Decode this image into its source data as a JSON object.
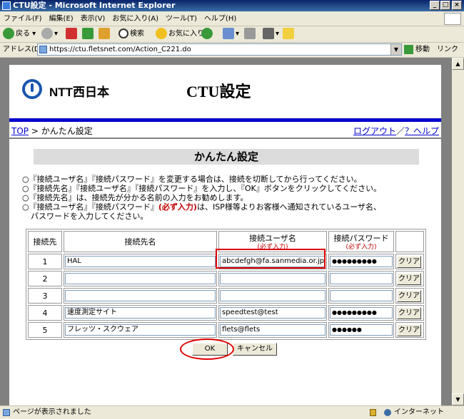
{
  "window": {
    "title": "CTU設定 - Microsoft Internet Explorer"
  },
  "menu": [
    "ファイル(F)",
    "編集(E)",
    "表示(V)",
    "お気に入り(A)",
    "ツール(T)",
    "ヘルプ(H)"
  ],
  "toolbar": {
    "back": "戻る",
    "search": "検索",
    "favorites": "お気に入り"
  },
  "address": {
    "label": "アドレス(D)",
    "url": "https://ctu.fletsnet.com/Action_C221.do",
    "go": "移動",
    "links": "リンク"
  },
  "page": {
    "logo_text": "NTT西日本",
    "title": "CTU設定",
    "breadcrumb_top": "TOP",
    "breadcrumb_sep": " > ",
    "breadcrumb_current": "かんたん設定",
    "logout": "ログアウト",
    "nav_sep": "／",
    "help": "？ヘルプ",
    "section_title": "かんたん設定",
    "notes": [
      "○『接続ユーザ名』『接続パスワード』を変更する場合は、接続を切断してから行ってください。",
      "○『接続先名』『接続ユーザ名』『接続パスワード』を入力し、『OK』ボタンをクリックしてください。",
      "○『接続先名』は、接続先が分かる名前の入力をお勧めします。"
    ],
    "note4_pre": "○『接続ユーザ名』『接続パスワード』",
    "note4_req": "(必ず入力)",
    "note4_post": "は、ISP様等よりお客様へ通知されているユーザ名、",
    "note4_line2": "パスワードを入力してください。",
    "table": {
      "headers": [
        "接続先",
        "接続先名",
        "接続ユーザ名",
        "接続パスワード"
      ],
      "required": "(必ず入力)",
      "clear_label": "クリア",
      "rows": [
        {
          "no": "1",
          "name": "HAL",
          "user": "abcdefgh@fa.sanmedia.or.jp",
          "password": "●●●●●●●●●"
        },
        {
          "no": "2",
          "name": "",
          "user": "",
          "password": ""
        },
        {
          "no": "3",
          "name": "",
          "user": "",
          "password": ""
        },
        {
          "no": "4",
          "name": "速度測定サイト",
          "user": "speedtest@test",
          "password": "●●●●●●●●●"
        },
        {
          "no": "5",
          "name": "フレッツ・スクウェア",
          "user": "flets@flets",
          "password": "●●●●●●"
        }
      ]
    },
    "ok_label": "OK",
    "cancel_label": "キャンセル"
  },
  "status": {
    "text": "ページが表示されました",
    "zone": "インターネット"
  }
}
